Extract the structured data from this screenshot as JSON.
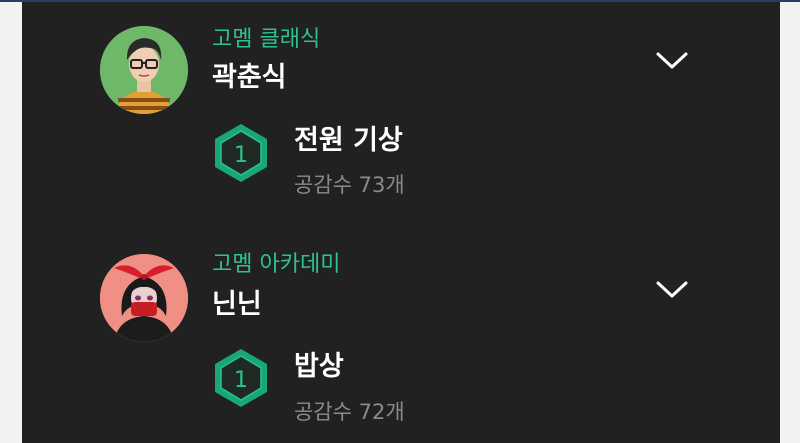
{
  "entries": [
    {
      "group": "고멤 클래식",
      "name": "곽춘식",
      "rank": "1",
      "title": "전원 기상",
      "likes": "공감수 73개",
      "avatar_bg": "#6fb86a"
    },
    {
      "group": "고멤 아카데미",
      "name": "닌닌",
      "rank": "1",
      "title": "밥상",
      "likes": "공감수 72개",
      "avatar_bg": "#f08f84"
    }
  ],
  "icons": {
    "expand": "chevron-down-icon",
    "rank": "hexagon-badge-icon"
  },
  "colors": {
    "background": "#212121",
    "accent": "#2ec38c",
    "muted_text": "#8a8a8a"
  }
}
